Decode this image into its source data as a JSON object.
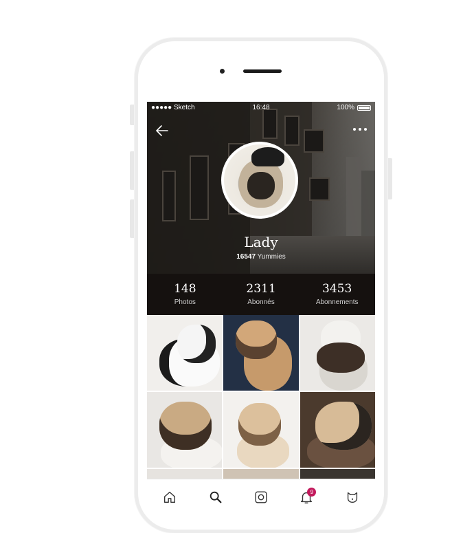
{
  "status_bar": {
    "carrier": "●●●●● Sketch",
    "time": "16:48",
    "battery": "100%"
  },
  "profile": {
    "name": "Lady",
    "yummies_count": "16547",
    "yummies_label": "Yummies"
  },
  "stats": [
    {
      "value": "148",
      "label": "Photos"
    },
    {
      "value": "2311",
      "label": "Abonnés"
    },
    {
      "value": "3453",
      "label": "Abonnements"
    }
  ],
  "tabbar": {
    "notification_badge": "9"
  },
  "icons": [
    "back-arrow-icon",
    "more-icon",
    "home-icon",
    "search-icon",
    "camera-icon",
    "bell-icon",
    "dog-face-icon"
  ],
  "colors": {
    "accent": "#c2185b",
    "stats_bar": "#15110f"
  }
}
